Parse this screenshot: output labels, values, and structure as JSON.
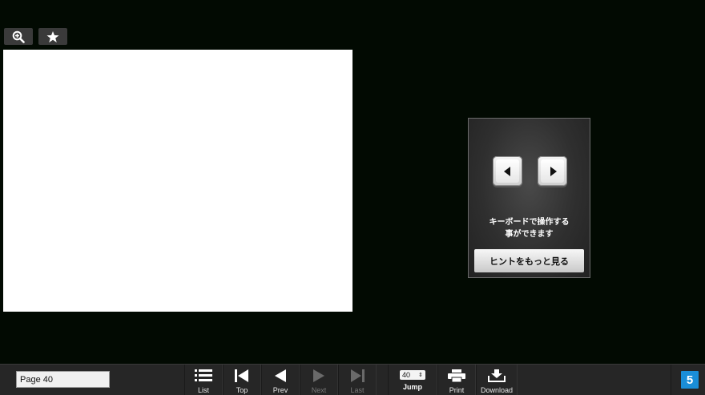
{
  "top_tools": {
    "zoom_icon": "zoom-in-icon",
    "favorite_icon": "star-icon"
  },
  "hint_panel": {
    "left_key_icon": "arrow-left-key-icon",
    "right_key_icon": "arrow-right-key-icon",
    "line1": "キーボードで操作する",
    "line2": "事ができます",
    "more_button": "ヒントをもっと見る"
  },
  "toolbar": {
    "page_input_value": "Page 40",
    "list_label": "List",
    "top_label": "Top",
    "prev_label": "Prev",
    "next_label": "Next",
    "last_label": "Last",
    "jump_value": "40",
    "jump_label": "Jump",
    "print_label": "Print",
    "download_label": "Download",
    "logo_text": "5"
  },
  "colors": {
    "background": "#020a02",
    "toolbar": "#262626",
    "logo": "#1a8ed8"
  }
}
